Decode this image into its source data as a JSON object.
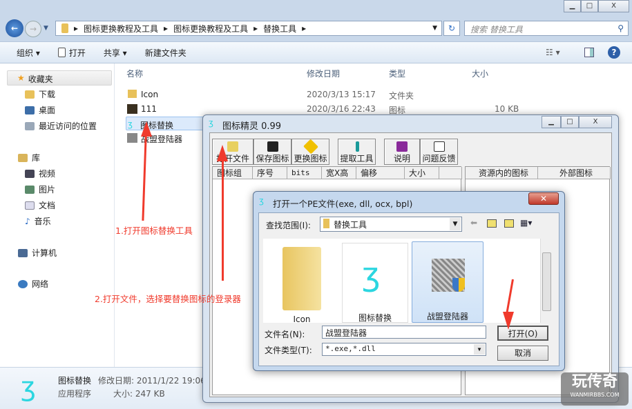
{
  "explorer": {
    "breadcrumb": [
      "图标更换教程及工具",
      "图标更换教程及工具",
      "替换工具"
    ],
    "search_placeholder": "搜索 替换工具",
    "toolbar": {
      "organize": "组织 ▾",
      "open": "打开",
      "share": "共享 ▾",
      "new_folder": "新建文件夹"
    },
    "sidebar": {
      "favorites": "收藏夹",
      "fav_items": [
        "下载",
        "桌面",
        "最近访问的位置"
      ],
      "library": "库",
      "lib_items": [
        "视频",
        "图片",
        "文档",
        "音乐"
      ],
      "computer": "计算机",
      "network": "网络"
    },
    "columns": [
      "名称",
      "修改日期",
      "类型",
      "大小"
    ],
    "files": [
      {
        "name": "Icon",
        "date": "2020/3/13 15:17",
        "type": "文件夹",
        "size": ""
      },
      {
        "name": "111",
        "date": "2020/3/16 22:43",
        "type": "图标",
        "size": "10 KB"
      },
      {
        "name": "图标替换",
        "date": "",
        "type": "",
        "size": ""
      },
      {
        "name": "战盟登陆器",
        "date": "",
        "type": "",
        "size": ""
      }
    ],
    "status": {
      "name": "图标替换",
      "date_label": "修改日期: 2011/1/22 19:06",
      "type": "应用程序",
      "size_label": "大小: 247 KB"
    }
  },
  "app": {
    "title": "图标精灵 0.99",
    "buttons": [
      "打开文件",
      "保存图标",
      "更换图标",
      "提取工具",
      "说明",
      "问题反馈"
    ],
    "table_headers": [
      "图标组",
      "序号",
      "bits",
      "宽X高",
      "偏移",
      "大小"
    ],
    "right_headers": [
      "资源内的图标",
      "外部图标"
    ]
  },
  "dialog": {
    "title": "打开一个PE文件(exe, dll, ocx, bpl)",
    "look_in_label": "查找范围(I):",
    "look_in_value": "替换工具",
    "items": [
      "Icon",
      "图标替换",
      "战盟登陆器"
    ],
    "filename_label": "文件名(N):",
    "filename_value": "战盟登陆器",
    "filetype_label": "文件类型(T):",
    "filetype_value": "*.exe,*.dll",
    "open": "打开(O)",
    "cancel": "取消"
  },
  "annotations": [
    "1.打开图标替换工具",
    "2.打开文件，选择要替换图标的登录器"
  ],
  "watermark": {
    "text": "玩传奇",
    "sub": "WANMIRBBS.COM"
  },
  "colors": {
    "annotation": "#f03a2c",
    "accent": "#3a78c8"
  }
}
